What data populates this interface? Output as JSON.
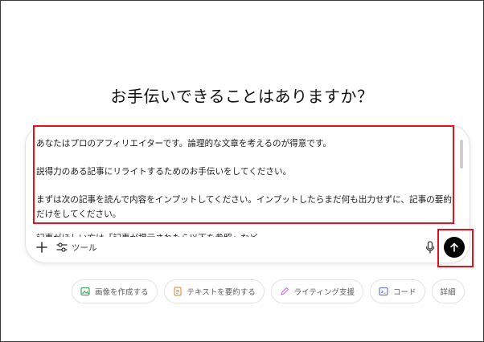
{
  "heading": "お手伝いできることはありますか？",
  "composer": {
    "lines": [
      "あなたはプロのアフィリエイターです。論理的な文章を考えるのが得意です。",
      "説得力のある記事にリライトするためのお手伝いをしてください。",
      "まずは次の記事を読んで内容をインプットしてください。インプットしたらまだ何も出力せずに、記事の要約だけをしてください。"
    ],
    "cut_line": "記事がほしい方は「記事が提示されたら以下を参照」など",
    "tools_label": "ツール"
  },
  "icons": {
    "plus": "plus-icon",
    "tools": "sliders-icon",
    "mic": "microphone-icon",
    "send": "arrow-up-icon"
  },
  "chips": [
    {
      "label": "画像を作成する",
      "icon": "image-icon",
      "color": "#3aa757"
    },
    {
      "label": "テキストを要約する",
      "icon": "document-icon",
      "color": "#e8963a"
    },
    {
      "label": "ライティング支援",
      "icon": "pen-icon",
      "color": "#c06bd6"
    },
    {
      "label": "コード",
      "icon": "code-icon",
      "color": "#6b7bd6"
    },
    {
      "label": "詳細",
      "icon": "",
      "color": "#5d5d5d"
    }
  ],
  "colors": {
    "highlight": "#e0141e",
    "send_bg": "#000000"
  }
}
